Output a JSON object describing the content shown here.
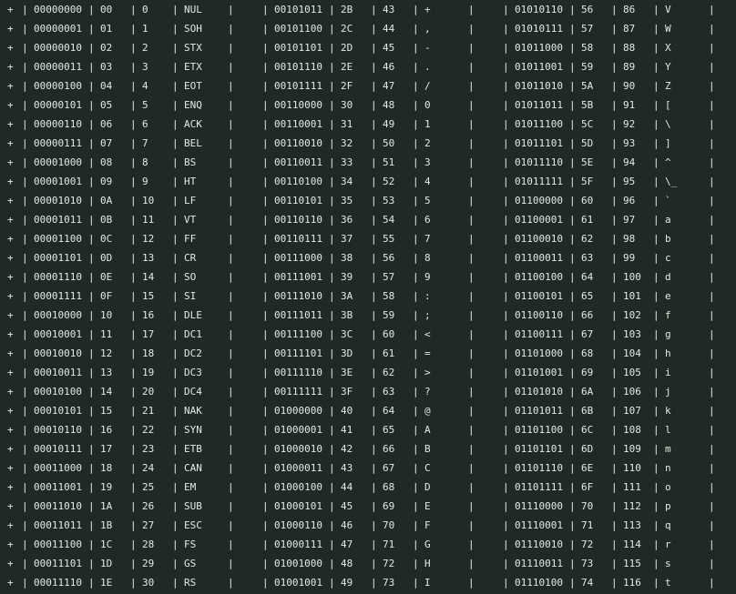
{
  "row_prefix": "+",
  "separator": "|",
  "rows": [
    [
      [
        "00000000",
        "00",
        "0",
        "NUL"
      ],
      [
        "00101011",
        "2B",
        "43",
        "+"
      ],
      [
        "01010110",
        "56",
        "86",
        "V"
      ]
    ],
    [
      [
        "00000001",
        "01",
        "1",
        "SOH"
      ],
      [
        "00101100",
        "2C",
        "44",
        ","
      ],
      [
        "01010111",
        "57",
        "87",
        "W"
      ]
    ],
    [
      [
        "00000010",
        "02",
        "2",
        "STX"
      ],
      [
        "00101101",
        "2D",
        "45",
        "-"
      ],
      [
        "01011000",
        "58",
        "88",
        "X"
      ]
    ],
    [
      [
        "00000011",
        "03",
        "3",
        "ETX"
      ],
      [
        "00101110",
        "2E",
        "46",
        "."
      ],
      [
        "01011001",
        "59",
        "89",
        "Y"
      ]
    ],
    [
      [
        "00000100",
        "04",
        "4",
        "EOT"
      ],
      [
        "00101111",
        "2F",
        "47",
        "/"
      ],
      [
        "01011010",
        "5A",
        "90",
        "Z"
      ]
    ],
    [
      [
        "00000101",
        "05",
        "5",
        "ENQ"
      ],
      [
        "00110000",
        "30",
        "48",
        "0"
      ],
      [
        "01011011",
        "5B",
        "91",
        "["
      ]
    ],
    [
      [
        "00000110",
        "06",
        "6",
        "ACK"
      ],
      [
        "00110001",
        "31",
        "49",
        "1"
      ],
      [
        "01011100",
        "5C",
        "92",
        "\\"
      ]
    ],
    [
      [
        "00000111",
        "07",
        "7",
        "BEL"
      ],
      [
        "00110010",
        "32",
        "50",
        "2"
      ],
      [
        "01011101",
        "5D",
        "93",
        "]"
      ]
    ],
    [
      [
        "00001000",
        "08",
        "8",
        "BS"
      ],
      [
        "00110011",
        "33",
        "51",
        "3"
      ],
      [
        "01011110",
        "5E",
        "94",
        "^"
      ]
    ],
    [
      [
        "00001001",
        "09",
        "9",
        "HT"
      ],
      [
        "00110100",
        "34",
        "52",
        "4"
      ],
      [
        "01011111",
        "5F",
        "95",
        "\\_"
      ]
    ],
    [
      [
        "00001010",
        "0A",
        "10",
        "LF"
      ],
      [
        "00110101",
        "35",
        "53",
        "5"
      ],
      [
        "01100000",
        "60",
        "96",
        "`"
      ]
    ],
    [
      [
        "00001011",
        "0B",
        "11",
        "VT"
      ],
      [
        "00110110",
        "36",
        "54",
        "6"
      ],
      [
        "01100001",
        "61",
        "97",
        "a"
      ]
    ],
    [
      [
        "00001100",
        "0C",
        "12",
        "FF"
      ],
      [
        "00110111",
        "37",
        "55",
        "7"
      ],
      [
        "01100010",
        "62",
        "98",
        "b"
      ]
    ],
    [
      [
        "00001101",
        "0D",
        "13",
        "CR"
      ],
      [
        "00111000",
        "38",
        "56",
        "8"
      ],
      [
        "01100011",
        "63",
        "99",
        "c"
      ]
    ],
    [
      [
        "00001110",
        "0E",
        "14",
        "SO"
      ],
      [
        "00111001",
        "39",
        "57",
        "9"
      ],
      [
        "01100100",
        "64",
        "100",
        "d"
      ]
    ],
    [
      [
        "00001111",
        "0F",
        "15",
        "SI"
      ],
      [
        "00111010",
        "3A",
        "58",
        ":"
      ],
      [
        "01100101",
        "65",
        "101",
        "e"
      ]
    ],
    [
      [
        "00010000",
        "10",
        "16",
        "DLE"
      ],
      [
        "00111011",
        "3B",
        "59",
        ";"
      ],
      [
        "01100110",
        "66",
        "102",
        "f"
      ]
    ],
    [
      [
        "00010001",
        "11",
        "17",
        "DC1"
      ],
      [
        "00111100",
        "3C",
        "60",
        "<"
      ],
      [
        "01100111",
        "67",
        "103",
        "g"
      ]
    ],
    [
      [
        "00010010",
        "12",
        "18",
        "DC2"
      ],
      [
        "00111101",
        "3D",
        "61",
        "="
      ],
      [
        "01101000",
        "68",
        "104",
        "h"
      ]
    ],
    [
      [
        "00010011",
        "13",
        "19",
        "DC3"
      ],
      [
        "00111110",
        "3E",
        "62",
        ">"
      ],
      [
        "01101001",
        "69",
        "105",
        "i"
      ]
    ],
    [
      [
        "00010100",
        "14",
        "20",
        "DC4"
      ],
      [
        "00111111",
        "3F",
        "63",
        "?"
      ],
      [
        "01101010",
        "6A",
        "106",
        "j"
      ]
    ],
    [
      [
        "00010101",
        "15",
        "21",
        "NAK"
      ],
      [
        "01000000",
        "40",
        "64",
        "@"
      ],
      [
        "01101011",
        "6B",
        "107",
        "k"
      ]
    ],
    [
      [
        "00010110",
        "16",
        "22",
        "SYN"
      ],
      [
        "01000001",
        "41",
        "65",
        "A"
      ],
      [
        "01101100",
        "6C",
        "108",
        "l"
      ]
    ],
    [
      [
        "00010111",
        "17",
        "23",
        "ETB"
      ],
      [
        "01000010",
        "42",
        "66",
        "B"
      ],
      [
        "01101101",
        "6D",
        "109",
        "m"
      ]
    ],
    [
      [
        "00011000",
        "18",
        "24",
        "CAN"
      ],
      [
        "01000011",
        "43",
        "67",
        "C"
      ],
      [
        "01101110",
        "6E",
        "110",
        "n"
      ]
    ],
    [
      [
        "00011001",
        "19",
        "25",
        "EM"
      ],
      [
        "01000100",
        "44",
        "68",
        "D"
      ],
      [
        "01101111",
        "6F",
        "111",
        "o"
      ]
    ],
    [
      [
        "00011010",
        "1A",
        "26",
        "SUB"
      ],
      [
        "01000101",
        "45",
        "69",
        "E"
      ],
      [
        "01110000",
        "70",
        "112",
        "p"
      ]
    ],
    [
      [
        "00011011",
        "1B",
        "27",
        "ESC"
      ],
      [
        "01000110",
        "46",
        "70",
        "F"
      ],
      [
        "01110001",
        "71",
        "113",
        "q"
      ]
    ],
    [
      [
        "00011100",
        "1C",
        "28",
        "FS"
      ],
      [
        "01000111",
        "47",
        "71",
        "G"
      ],
      [
        "01110010",
        "72",
        "114",
        "r"
      ]
    ],
    [
      [
        "00011101",
        "1D",
        "29",
        "GS"
      ],
      [
        "01001000",
        "48",
        "72",
        "H"
      ],
      [
        "01110011",
        "73",
        "115",
        "s"
      ]
    ],
    [
      [
        "00011110",
        "1E",
        "30",
        "RS"
      ],
      [
        "01001001",
        "49",
        "73",
        "I"
      ],
      [
        "01110100",
        "74",
        "116",
        "t"
      ]
    ]
  ]
}
